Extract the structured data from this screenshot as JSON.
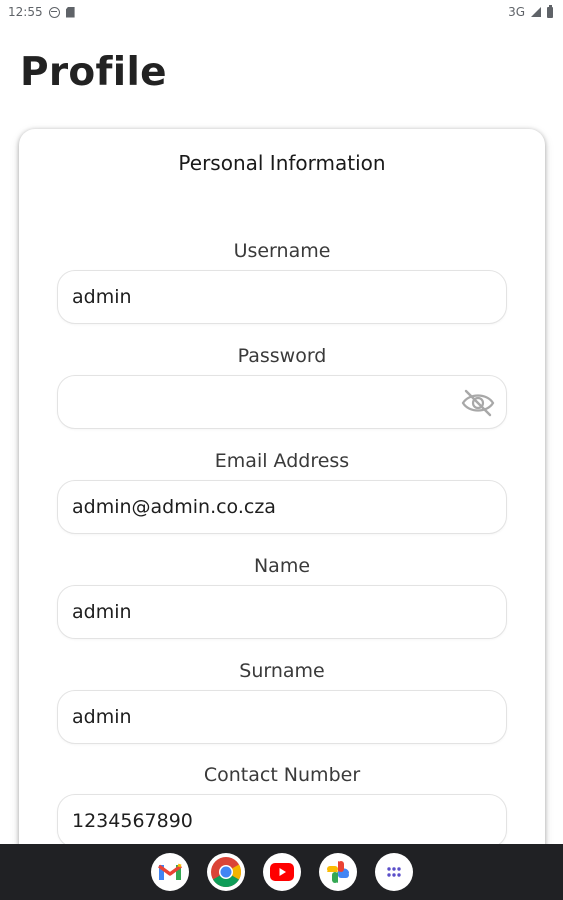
{
  "status_bar": {
    "time": "12:55",
    "network": "3G",
    "icons": [
      "dnd-icon",
      "sd-card-icon",
      "signal-icon",
      "battery-icon"
    ]
  },
  "page": {
    "title": "Profile"
  },
  "card": {
    "title": "Personal Information",
    "fields": [
      {
        "label": "Username",
        "value": "admin"
      },
      {
        "label": "Password",
        "value": "",
        "icon": "eye-off-icon"
      },
      {
        "label": "Email Address",
        "value": "admin@admin.co.cza"
      },
      {
        "label": "Name",
        "value": "admin"
      },
      {
        "label": "Surname",
        "value": "admin"
      },
      {
        "label": "Contact Number",
        "value": "1234567890"
      }
    ]
  },
  "dock": {
    "apps": [
      "gmail-icon",
      "chrome-icon",
      "youtube-icon",
      "photos-icon",
      "app-drawer-icon"
    ]
  },
  "colors": {
    "background": "#ffffff",
    "dock_background": "#202124",
    "input_border": "#e3e3e3"
  }
}
